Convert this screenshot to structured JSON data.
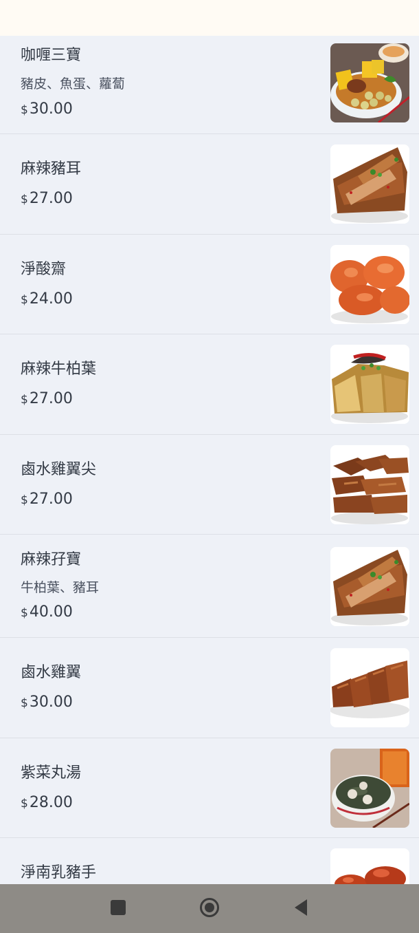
{
  "menu": {
    "currency_symbol": "$",
    "items": [
      {
        "name": "咖喱三寶",
        "description": "豬皮、魚蛋、蘿蔔",
        "price": "30.00",
        "image_icon": "curry-three-treasures-photo"
      },
      {
        "name": "麻辣豬耳",
        "description": "",
        "price": "27.00",
        "image_icon": "spicy-pig-ear-photo"
      },
      {
        "name": "淨酸齋",
        "description": "",
        "price": "24.00",
        "image_icon": "sweet-sour-gluten-photo"
      },
      {
        "name": "麻辣牛柏葉",
        "description": "",
        "price": "27.00",
        "image_icon": "spicy-beef-tripe-photo"
      },
      {
        "name": "鹵水雞翼尖",
        "description": "",
        "price": "27.00",
        "image_icon": "braised-wing-tips-photo"
      },
      {
        "name": "麻辣孖寶",
        "description": "牛柏葉、豬耳",
        "price": "40.00",
        "image_icon": "spicy-double-treasure-photo"
      },
      {
        "name": "鹵水雞翼",
        "description": "",
        "price": "30.00",
        "image_icon": "braised-chicken-wings-photo"
      },
      {
        "name": "紫菜丸湯",
        "description": "",
        "price": "28.00",
        "image_icon": "seaweed-ball-soup-photo"
      },
      {
        "name": "淨南乳豬手",
        "description": "",
        "price": "",
        "image_icon": "pork-knuckle-photo"
      }
    ]
  },
  "nav": {
    "recents_icon": "square-icon",
    "home_icon": "circle-icon",
    "back_icon": "triangle-back-icon"
  }
}
